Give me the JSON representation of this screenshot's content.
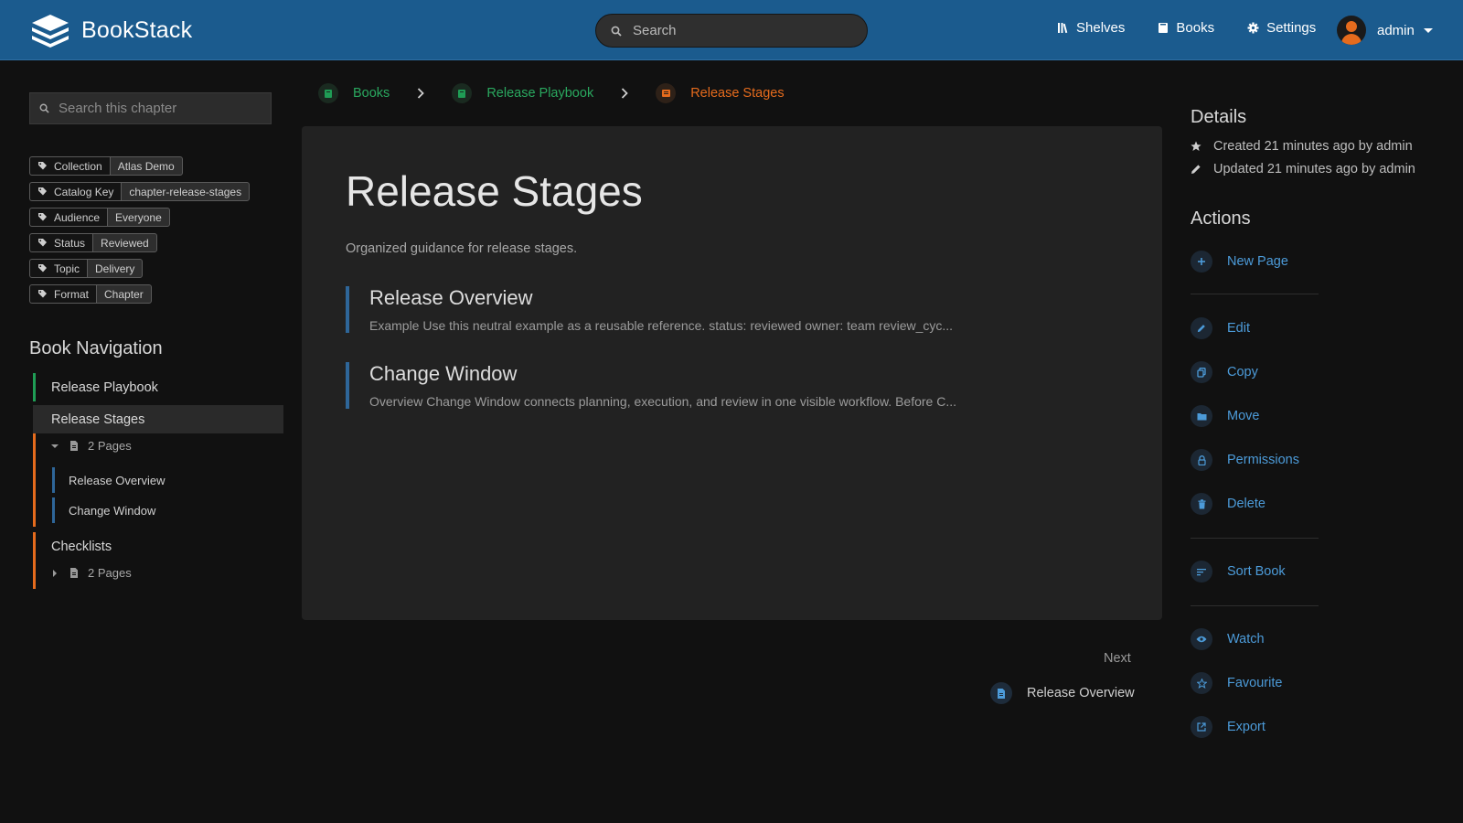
{
  "header": {
    "app_name": "BookStack",
    "search_placeholder": "Search",
    "nav": [
      {
        "label": "Shelves",
        "icon": "shelves-icon"
      },
      {
        "label": "Books",
        "icon": "book-icon"
      },
      {
        "label": "Settings",
        "icon": "gear-icon"
      }
    ],
    "user_name": "admin"
  },
  "sidebar": {
    "search_placeholder": "Search this chapter",
    "tags": [
      {
        "name": "Collection",
        "value": "Atlas Demo"
      },
      {
        "name": "Catalog Key",
        "value": "chapter-release-stages"
      },
      {
        "name": "Audience",
        "value": "Everyone"
      },
      {
        "name": "Status",
        "value": "Reviewed"
      },
      {
        "name": "Topic",
        "value": "Delivery"
      },
      {
        "name": "Format",
        "value": "Chapter"
      }
    ],
    "book_nav_title": "Book Navigation",
    "book_nav": {
      "book": "Release Playbook",
      "current_chapter": "Release Stages",
      "current_chapter_pages_count": "2 Pages",
      "pages": [
        "Release Overview",
        "Change Window"
      ],
      "other_chapter": "Checklists",
      "other_chapter_pages_count": "2 Pages"
    }
  },
  "breadcrumb": [
    "Books",
    "Release Playbook",
    "Release Stages"
  ],
  "main": {
    "title": "Release Stages",
    "description": "Organized guidance for release stages.",
    "pages": [
      {
        "title": "Release Overview",
        "excerpt": "Example Use this neutral example as a reusable reference. status: reviewed owner: team review_cyc..."
      },
      {
        "title": "Change Window",
        "excerpt": "Overview Change Window connects planning, execution, and review in one visible workflow. Before C..."
      }
    ],
    "next_label": "Next",
    "next_page": "Release Overview"
  },
  "details": {
    "title": "Details",
    "created": "Created 21 minutes ago by admin",
    "updated": "Updated 21 minutes ago by admin"
  },
  "actions": {
    "title": "Actions",
    "new_page": "New Page",
    "edit": "Edit",
    "copy": "Copy",
    "move": "Move",
    "permissions": "Permissions",
    "delete": "Delete",
    "sort_book": "Sort Book",
    "watch": "Watch",
    "favourite": "Favourite",
    "export": "Export"
  },
  "colors": {
    "header_bg": "#1b5b8e",
    "book_green": "#1f9d55",
    "chapter_orange": "#e56b1d",
    "page_blue": "#2e6699",
    "link_blue": "#4c9bd9"
  }
}
